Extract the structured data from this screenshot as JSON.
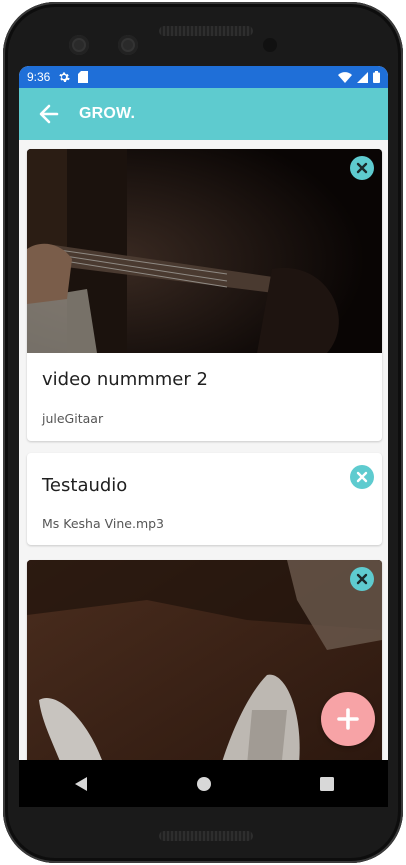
{
  "status_bar": {
    "time": "9:36"
  },
  "app_bar": {
    "title": "GROW."
  },
  "cards": [
    {
      "title": "video nummmer 2",
      "subtitle": "juleGitaar"
    },
    {
      "title": "Testaudio",
      "subtitle": "Ms Kesha Vine.mp3"
    },
    {
      "title": "",
      "subtitle": ""
    }
  ],
  "colors": {
    "status_bar": "#1f6fd8",
    "app_bar": "#5ecbcf",
    "close_button": "#5ecbcf",
    "fab": "#f7a3a6"
  },
  "icons": {
    "back": "arrow-left-icon",
    "close": "close-icon",
    "fab": "plus-icon",
    "nav": [
      "back-triangle-icon",
      "home-circle-icon",
      "recents-square-icon"
    ]
  }
}
